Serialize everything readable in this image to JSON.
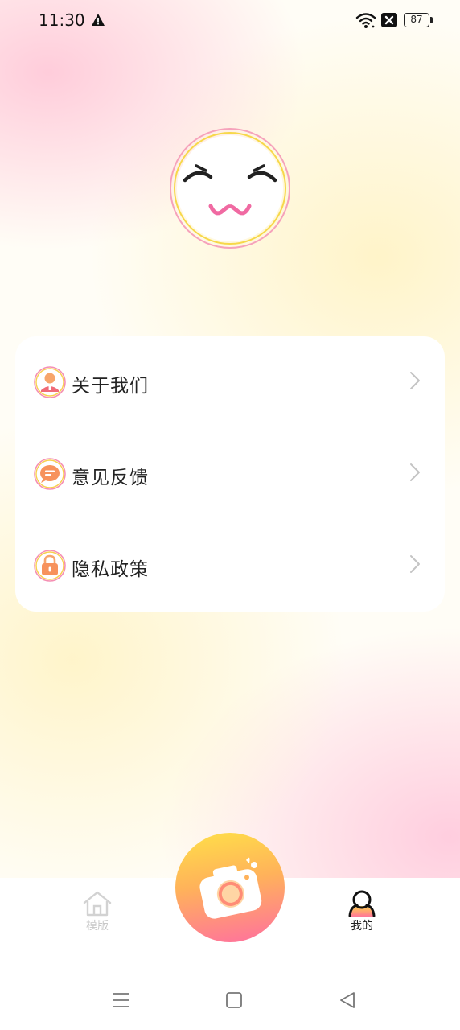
{
  "status_bar": {
    "time": "11:30",
    "battery": "87",
    "icons": [
      "warning-icon",
      "wifi-icon",
      "no-sim-icon",
      "battery-icon"
    ]
  },
  "profile": {
    "avatar_icon": "cute-smiley-face-icon"
  },
  "menu": {
    "items": [
      {
        "label": "关于我们",
        "icon": "person-icon"
      },
      {
        "label": "意见反馈",
        "icon": "chat-bubble-icon"
      },
      {
        "label": "隐私政策",
        "icon": "lock-icon"
      }
    ]
  },
  "bottom_nav": {
    "tabs": [
      {
        "label": "模版",
        "icon": "home-icon",
        "active": false
      },
      {
        "label": "我的",
        "icon": "user-icon",
        "active": true
      }
    ],
    "center_button_icon": "camera-icon"
  },
  "system_nav": {
    "icons": [
      "menu-icon",
      "home-square-icon",
      "back-triangle-icon"
    ]
  },
  "colors": {
    "accent_yellow": "#ffe048",
    "accent_orange": "#ffb25a",
    "accent_pink": "#ff6fa0",
    "menu_text": "#222222",
    "inactive_tab": "#c8c8c8"
  }
}
